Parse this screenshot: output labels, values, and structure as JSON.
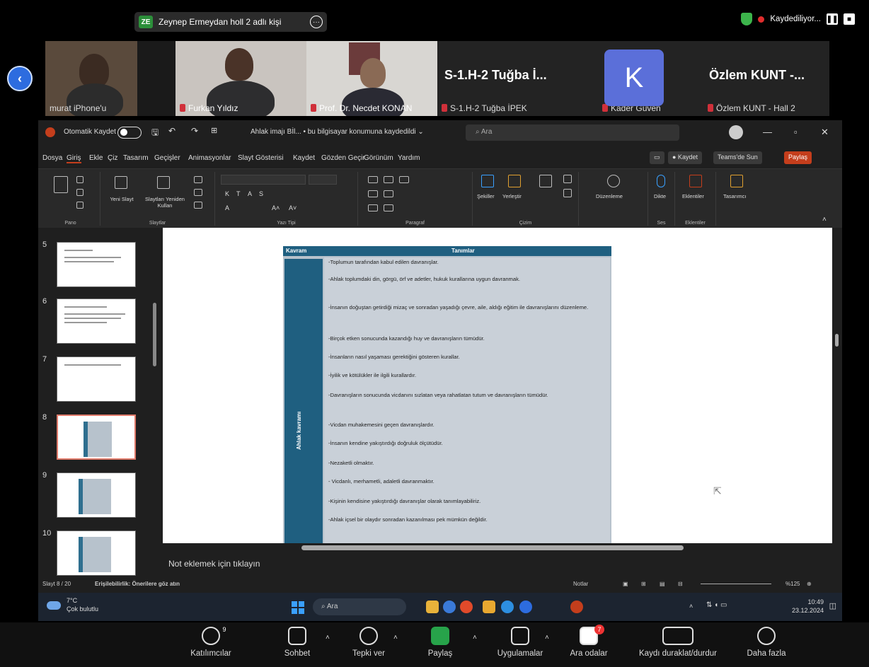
{
  "zoom": {
    "share_banner": "Zeynep Ermeydan holl 2 adlı kişi",
    "share_initials": "ZE",
    "recording_label": "Kaydediliyor...",
    "participants": [
      {
        "label": "murat iPhone'u"
      },
      {
        "label": "Furkan Yıldız"
      },
      {
        "label": "Prof. Dr. Necdet KONAN"
      },
      {
        "label": "S-1.H-2 Tuğba İPEK",
        "big": "S-1.H-2 Tuğba İ..."
      },
      {
        "label": "Kader Güven",
        "initial": "K"
      },
      {
        "label": "Özlem KUNT - Hall 2",
        "big": "Özlem KUNT -..."
      }
    ],
    "toolbar": [
      {
        "label": "Katılımcılar",
        "badge": "9"
      },
      {
        "label": "Sohbet"
      },
      {
        "label": "Tepki ver"
      },
      {
        "label": "Paylaş"
      },
      {
        "label": "Uygulamalar"
      },
      {
        "label": "Ara odalar",
        "badge": "7"
      },
      {
        "label": "Kaydı duraklat/durdur"
      },
      {
        "label": "Daha fazla"
      }
    ]
  },
  "ppt": {
    "autosave_label": "Otomatik Kaydet",
    "file_title": "Ahlak imajı Bİl... • bu bilgisayar konumuna kaydedildi ⌄",
    "search_placeholder": "Ara",
    "menu": [
      "Dosya",
      "Giriş",
      "Ekle",
      "Çiz",
      "Tasarım",
      "Geçişler",
      "Animasyonlar",
      "Slayt Gösterisi",
      "Kaydet",
      "Gözden Geçir",
      "Görünüm",
      "Yardım"
    ],
    "menu_buttons": {
      "record": "● Kaydet",
      "present": "Teams'de Sun",
      "share": "Paylaş"
    },
    "ribbon_groups": [
      "Pano",
      "Slaytlar",
      "Yazı Tipi",
      "Paragraf",
      "Çizim",
      "Ses",
      "Eklentiler"
    ],
    "ribbon_labels": {
      "new_slide": "Yeni Slayt",
      "reuse": "Slaytları Yeniden Kullan",
      "shapes": "Şekiller",
      "arrange": "Yerleştir",
      "edit": "Düzenleme",
      "dictate": "Dikte",
      "addins": "Eklentiler",
      "designer": "Tasarımcı"
    },
    "slides": [
      {
        "num": "5"
      },
      {
        "num": "6"
      },
      {
        "num": "7"
      },
      {
        "num": "8",
        "selected": true
      },
      {
        "num": "9"
      },
      {
        "num": "10"
      }
    ],
    "table": {
      "col1": "Kavram",
      "col2": "Tanımlar",
      "row_label": "Ahlak kavramı",
      "definitions": [
        "-Toplumun tarafından kabul edilen davranışlar.",
        "-Ahlak toplumdaki din, görgü, örf ve adetler, hukuk kurallarına uygun davranmak.",
        "-İnsanın doğuştan getirdiği mizaç ve sonradan yaşadığı çevre, aile, aldığı eğitim ile davranışlarını düzenleme.",
        "-Birçok etken sonucunda kazandığı huy ve davranışların tümüdür.",
        "-İnsanların nasıl yaşaması gerektiğini gösteren kurallar.",
        "-İyilik ve kötülükler ile ilgili kurallardır.",
        "-Davranışların sonucunda vicdanını sızlatan veya rahatlatan tutum ve davranışların tümüdür.",
        "-Vicdan muhakemesini geçen davranışlardır.",
        "-İnsanın kendine yakıştırdığı doğruluk ölçütüdür.",
        "-Nezaketli olmaktır.",
        "- Vicdanlı, merhametli, adaletli davranmaktır.",
        "-Kişinin kendisine yakıştırdığı davranışlar olarak tanımlayabiliriz.",
        "-Ahlak içsel bir olaydır sonradan kazanılması pek mümkün değildir."
      ]
    },
    "notes_placeholder": "Not eklemek için tıklayın",
    "status": {
      "slide": "Slayt 8 / 20",
      "accessibility": "Erişilebilirlik: Önerilere göz atın",
      "notes": "Notlar",
      "zoom": "%125"
    }
  },
  "taskbar": {
    "temp": "7°C",
    "weather": "Çok bulutlu",
    "search": "Ara",
    "time": "10:49",
    "date": "23.12.2024"
  }
}
